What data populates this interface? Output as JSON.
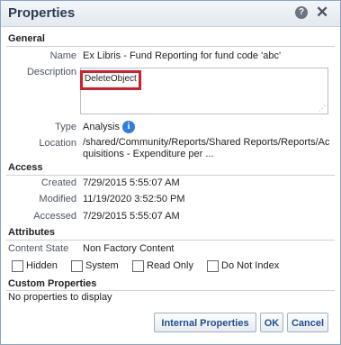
{
  "dialog": {
    "title": "Properties",
    "help_icon": "question-circle-icon",
    "close_icon": "close-icon"
  },
  "general": {
    "heading": "General",
    "name_label": "Name",
    "name_value": "Ex Libris - Fund Reporting for fund code 'abc'",
    "description_label": "Description",
    "description_value": "DeleteObject",
    "type_label": "Type",
    "type_value": "Analysis",
    "location_label": "Location",
    "location_line1": "/shared/Community/Reports/Shared Reports/Reports/Ac",
    "location_line2": "quisitions - Expenditure per ..."
  },
  "access": {
    "heading": "Access",
    "created_label": "Created",
    "created_value": "7/29/2015 5:55:07 AM",
    "modified_label": "Modified",
    "modified_value": "11/19/2020 3:52:50 PM",
    "accessed_label": "Accessed",
    "accessed_value": "7/29/2015 5:55:07 AM"
  },
  "attributes": {
    "heading": "Attributes",
    "content_state_label": "Content State",
    "content_state_value": "Non Factory Content",
    "checkboxes": [
      {
        "label": "Hidden",
        "checked": false
      },
      {
        "label": "System",
        "checked": false
      },
      {
        "label": "Read Only",
        "checked": false
      },
      {
        "label": "Do Not Index",
        "checked": false
      }
    ]
  },
  "custom": {
    "heading": "Custom Properties",
    "empty_text": "No properties to display"
  },
  "buttons": {
    "internal": "Internal Properties",
    "ok": "OK",
    "cancel": "Cancel"
  },
  "colors": {
    "highlight": "#d21f2b",
    "link": "#1f4f8f",
    "info_icon": "#2f7fd8"
  }
}
